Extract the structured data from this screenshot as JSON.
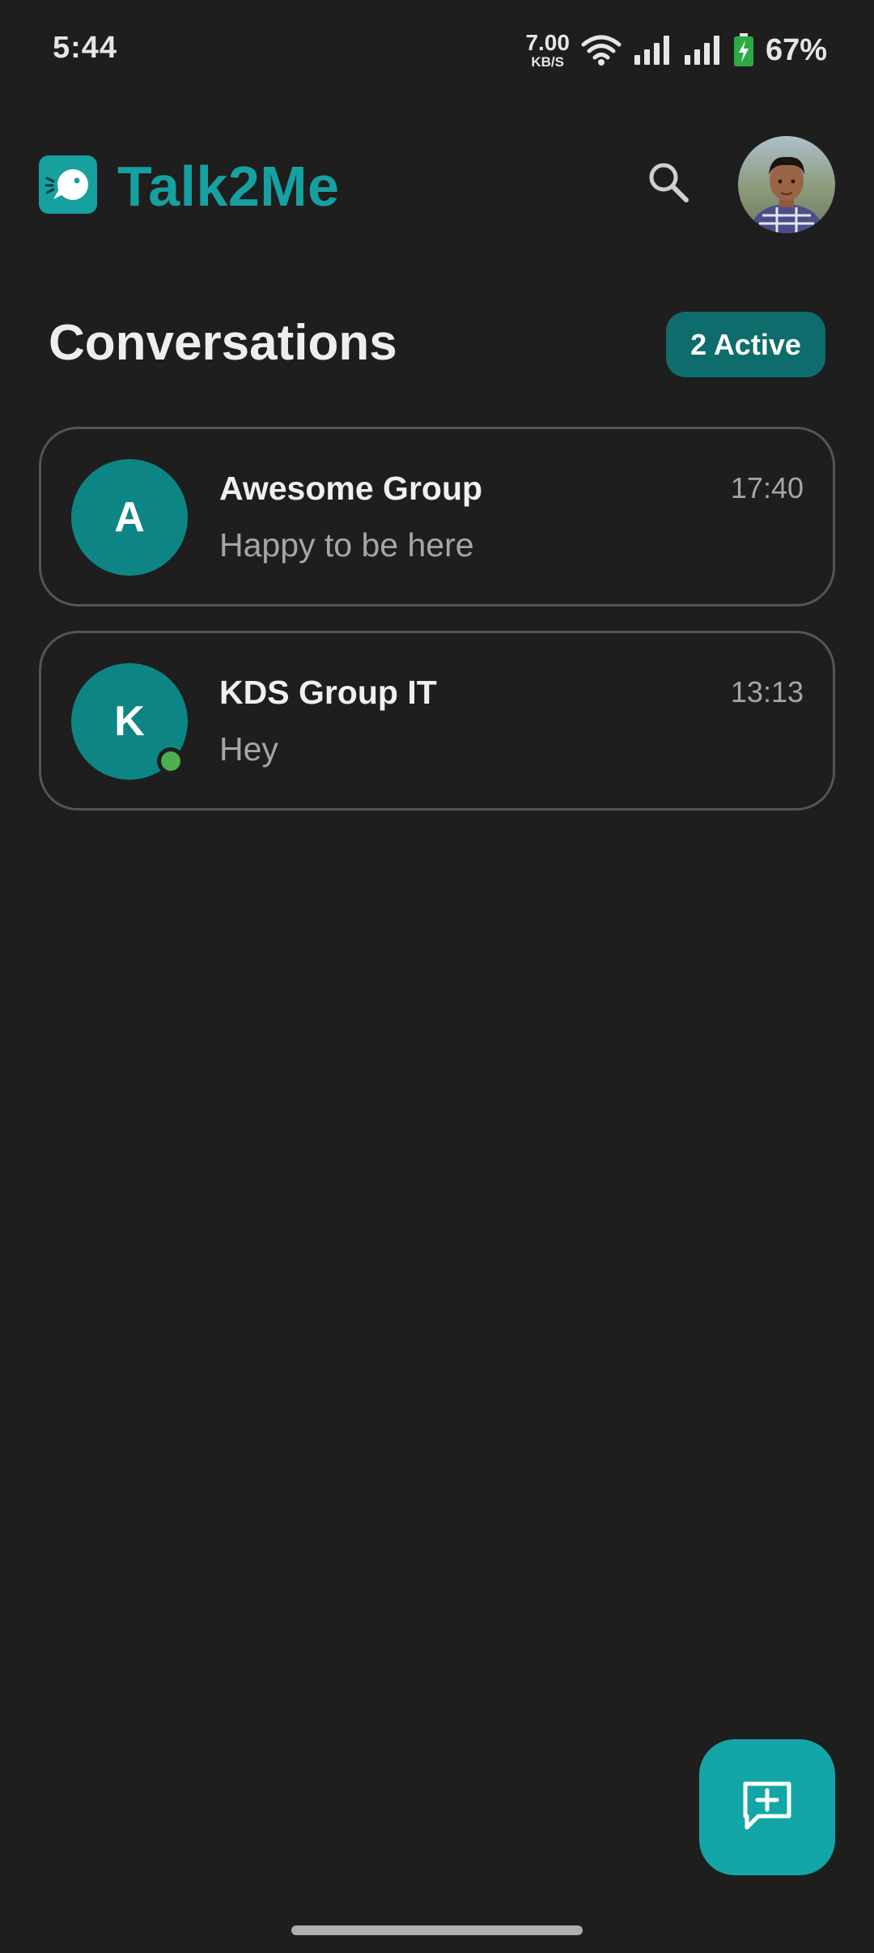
{
  "status_bar": {
    "time": "5:44",
    "net_speed_value": "7.00",
    "net_speed_unit": "KB/S",
    "battery_percent": "67%",
    "icons": [
      "wifi-icon",
      "signal-icon",
      "signal-icon",
      "battery-charging-icon"
    ]
  },
  "app_bar": {
    "title": "Talk2Me",
    "logo_icon": "chat-bubble-logo-icon",
    "search_icon": "search-icon",
    "avatar": "profile-avatar"
  },
  "header": {
    "title": "Conversations",
    "active_badge": "2 Active"
  },
  "conversations": [
    {
      "initial": "A",
      "name": "Awesome Group",
      "last_message": "Happy to be here",
      "time": "17:40",
      "online": false
    },
    {
      "initial": "K",
      "name": "KDS Group IT",
      "last_message": "Hey",
      "time": "13:13",
      "online": true
    }
  ],
  "fab": {
    "icon": "new-chat-icon"
  },
  "colors": {
    "background": "#1e1e1e",
    "accent": "#17a0a0",
    "badge": "#0f6c6c",
    "avatar": "#0e8585",
    "online": "#4caf50",
    "fab": "#14a6a6"
  }
}
